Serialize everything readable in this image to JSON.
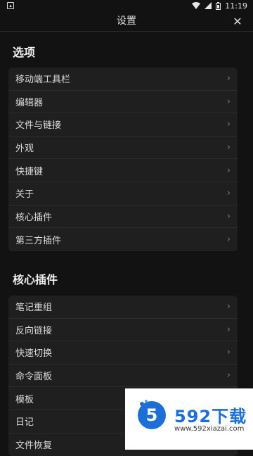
{
  "status_bar": {
    "time": "11:19",
    "notification_icon": "notification-icon"
  },
  "header": {
    "title": "设置",
    "close_label": "✕"
  },
  "sections": [
    {
      "title": "选项",
      "items": [
        {
          "label": "移动端工具栏"
        },
        {
          "label": "编辑器"
        },
        {
          "label": "文件与链接"
        },
        {
          "label": "外观"
        },
        {
          "label": "快捷键"
        },
        {
          "label": "关于"
        },
        {
          "label": "核心插件"
        },
        {
          "label": "第三方插件"
        }
      ]
    },
    {
      "title": "核心插件",
      "items": [
        {
          "label": "笔记重组"
        },
        {
          "label": "反向链接"
        },
        {
          "label": "快速切换"
        },
        {
          "label": "命令面板"
        },
        {
          "label": "模板"
        },
        {
          "label": "日记"
        },
        {
          "label": "文件恢复"
        }
      ]
    }
  ],
  "chevron": "›",
  "watermark": {
    "brand": "592下载",
    "url": "www.592xiazai.com"
  },
  "colors": {
    "background": "#121212",
    "card": "#1f1f1f",
    "divider": "#2c2c2c",
    "text": "#dcdcdc",
    "watermark_blue": "#1d6fd8"
  }
}
